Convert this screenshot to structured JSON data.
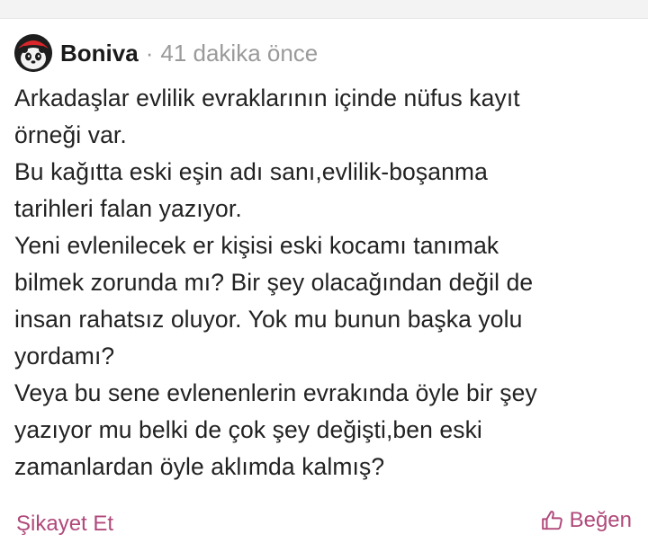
{
  "post": {
    "author": "Boniva",
    "separator": "·",
    "time_ago": "41 dakika önce",
    "lines": [
      "Arkadaşlar evlilik evraklarının içinde nüfus kayıt",
      "örneği var.",
      "Bu kağıtta eski eşin adı sanı,evlilik-boşanma",
      "tarihleri falan yazıyor.",
      "Yeni evlenilecek er kişisi eski kocamı tanımak",
      "bilmek zorunda mı? Bir şey olacağından değil de",
      "insan rahatsız oluyor. Yok mu bunun başka yolu",
      "yordamı?",
      "Veya bu sene evlenenlerin evrakında öyle bir şey",
      "yazıyor mu belki de çok şey değişti,ben eski",
      "zamanlardan öyle aklımda kalmış?"
    ],
    "actions": {
      "report_label": "Şikayet Et",
      "like_label": "Beğen"
    }
  },
  "colors": {
    "accent": "#b0497a",
    "meta": "#9a9a9a",
    "text": "#222222"
  },
  "icons": {
    "avatar": "panda-avatar",
    "like": "thumbs-up-icon"
  }
}
